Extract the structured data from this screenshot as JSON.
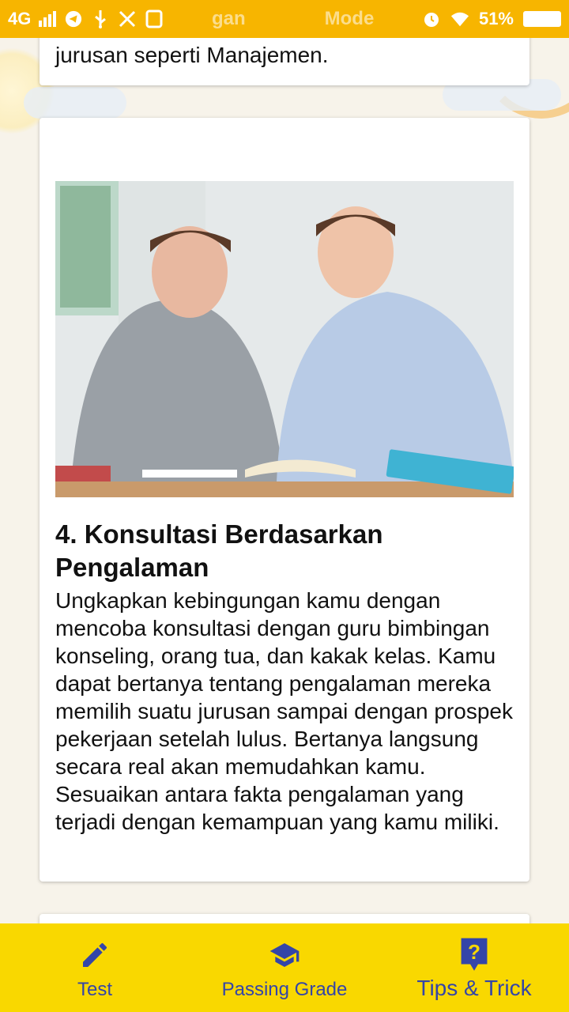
{
  "status_bar": {
    "network": "4G",
    "carrier_text": "gan",
    "mode_text": "Mode",
    "battery_percent": "51%",
    "icons": [
      "signal-icon",
      "telegram-icon",
      "usb-icon",
      "tools-icon",
      "app-icon",
      "alarm-icon",
      "wifi-icon",
      "battery-icon"
    ]
  },
  "top_card": {
    "text": "jurusan seperti Manajemen."
  },
  "main_card": {
    "image_alt": "two-students-studying-photo",
    "title": "4. Konsultasi Berdasarkan Pengalaman",
    "body": "Ungkapkan kebingungan kamu dengan mencoba konsultasi dengan guru bimbingan konseling, orang tua, dan kakak kelas. Kamu dapat bertanya tentang pengalaman mereka memilih suatu jurusan sampai dengan prospek pekerjaan setelah lulus. Bertanya langsung secara real akan memudahkan kamu. Sesuaikan antara fakta pengalaman yang terjadi dengan kemampuan yang kamu miliki."
  },
  "bottom_nav": {
    "items": [
      {
        "label": "Test",
        "icon": "pencil-icon"
      },
      {
        "label": "Passing Grade",
        "icon": "graduation-cap-icon"
      },
      {
        "label": "Tips & Trick",
        "icon": "question-icon"
      }
    ],
    "active_index": 2
  },
  "colors": {
    "status_bar": "#f7b500",
    "bottom_nav": "#f9d800",
    "nav_icon": "#3445a8"
  }
}
